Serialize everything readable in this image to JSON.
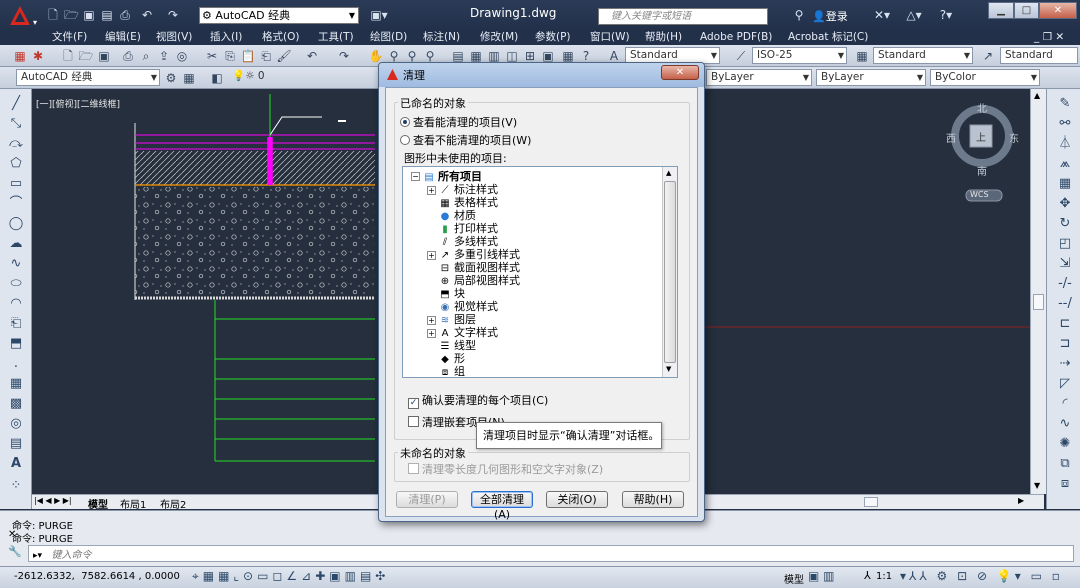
{
  "title_bar": {
    "workspace": "AutoCAD 经典",
    "document_title": "Drawing1.dwg",
    "search_placeholder": "键入关键字或短语",
    "login_label": "登录"
  },
  "menu": [
    "文件(F)",
    "编辑(E)",
    "视图(V)",
    "插入(I)",
    "格式(O)",
    "工具(T)",
    "绘图(D)",
    "标注(N)",
    "修改(M)",
    "参数(P)",
    "窗口(W)",
    "帮助(H)",
    "Adobe PDF(B)",
    "Acrobat 标记(C)"
  ],
  "toolbar": {
    "text_style": "Standard",
    "dim_style": "ISO-25",
    "table_style": "Standard",
    "mleader_style": "Standard",
    "workspace_combo": "AutoCAD 经典",
    "layer_combo": "0",
    "color_combo": "ByLayer",
    "linetype_combo": "ByLayer",
    "lineweight_combo": "ByColor"
  },
  "viewport": {
    "label": "[一][俯视][二维线框]",
    "viewcube_n": "北",
    "viewcube_s": "南",
    "viewcube_e": "东",
    "viewcube_w": "西",
    "viewcube_top": "上",
    "wcs": "WCS"
  },
  "layout_tabs": [
    "模型",
    "布局1",
    "布局2"
  ],
  "dialog": {
    "title": "清理",
    "named_group": "已命名的对象",
    "radio_purgeable": "查看能清理的项目(V)",
    "radio_non_purgeable": "查看不能清理的项目(W)",
    "unused_label": "图形中未使用的项目:",
    "tree_root": "所有项目",
    "tree_items": [
      "标注样式",
      "表格样式",
      "材质",
      "打印样式",
      "多线样式",
      "多重引线样式",
      "截面视图样式",
      "局部视图样式",
      "块",
      "视觉样式",
      "图层",
      "文字样式",
      "线型",
      "形",
      "组"
    ],
    "confirm_each": "确认要清理的每个项目(C)",
    "purge_nested": "清理嵌套项目(N)",
    "unnamed_group": "未命名的对象",
    "purge_zero_length": "清理零长度几何图形和空文字对象(Z)",
    "buttons": {
      "purge": "清理(P)",
      "purge_all": "全部清理(A)",
      "close": "关闭(O)",
      "help": "帮助(H)"
    }
  },
  "tooltip": "清理项目时显示“确认清理”对话框。",
  "command_history": [
    "命令: PURGE",
    "命令: PURGE"
  ],
  "command_placeholder": "键入命令",
  "coordinates": "-2612.6332,  7582.6614 , 0.0000",
  "status_right": {
    "model_label": "模型",
    "scale": "1:1"
  }
}
